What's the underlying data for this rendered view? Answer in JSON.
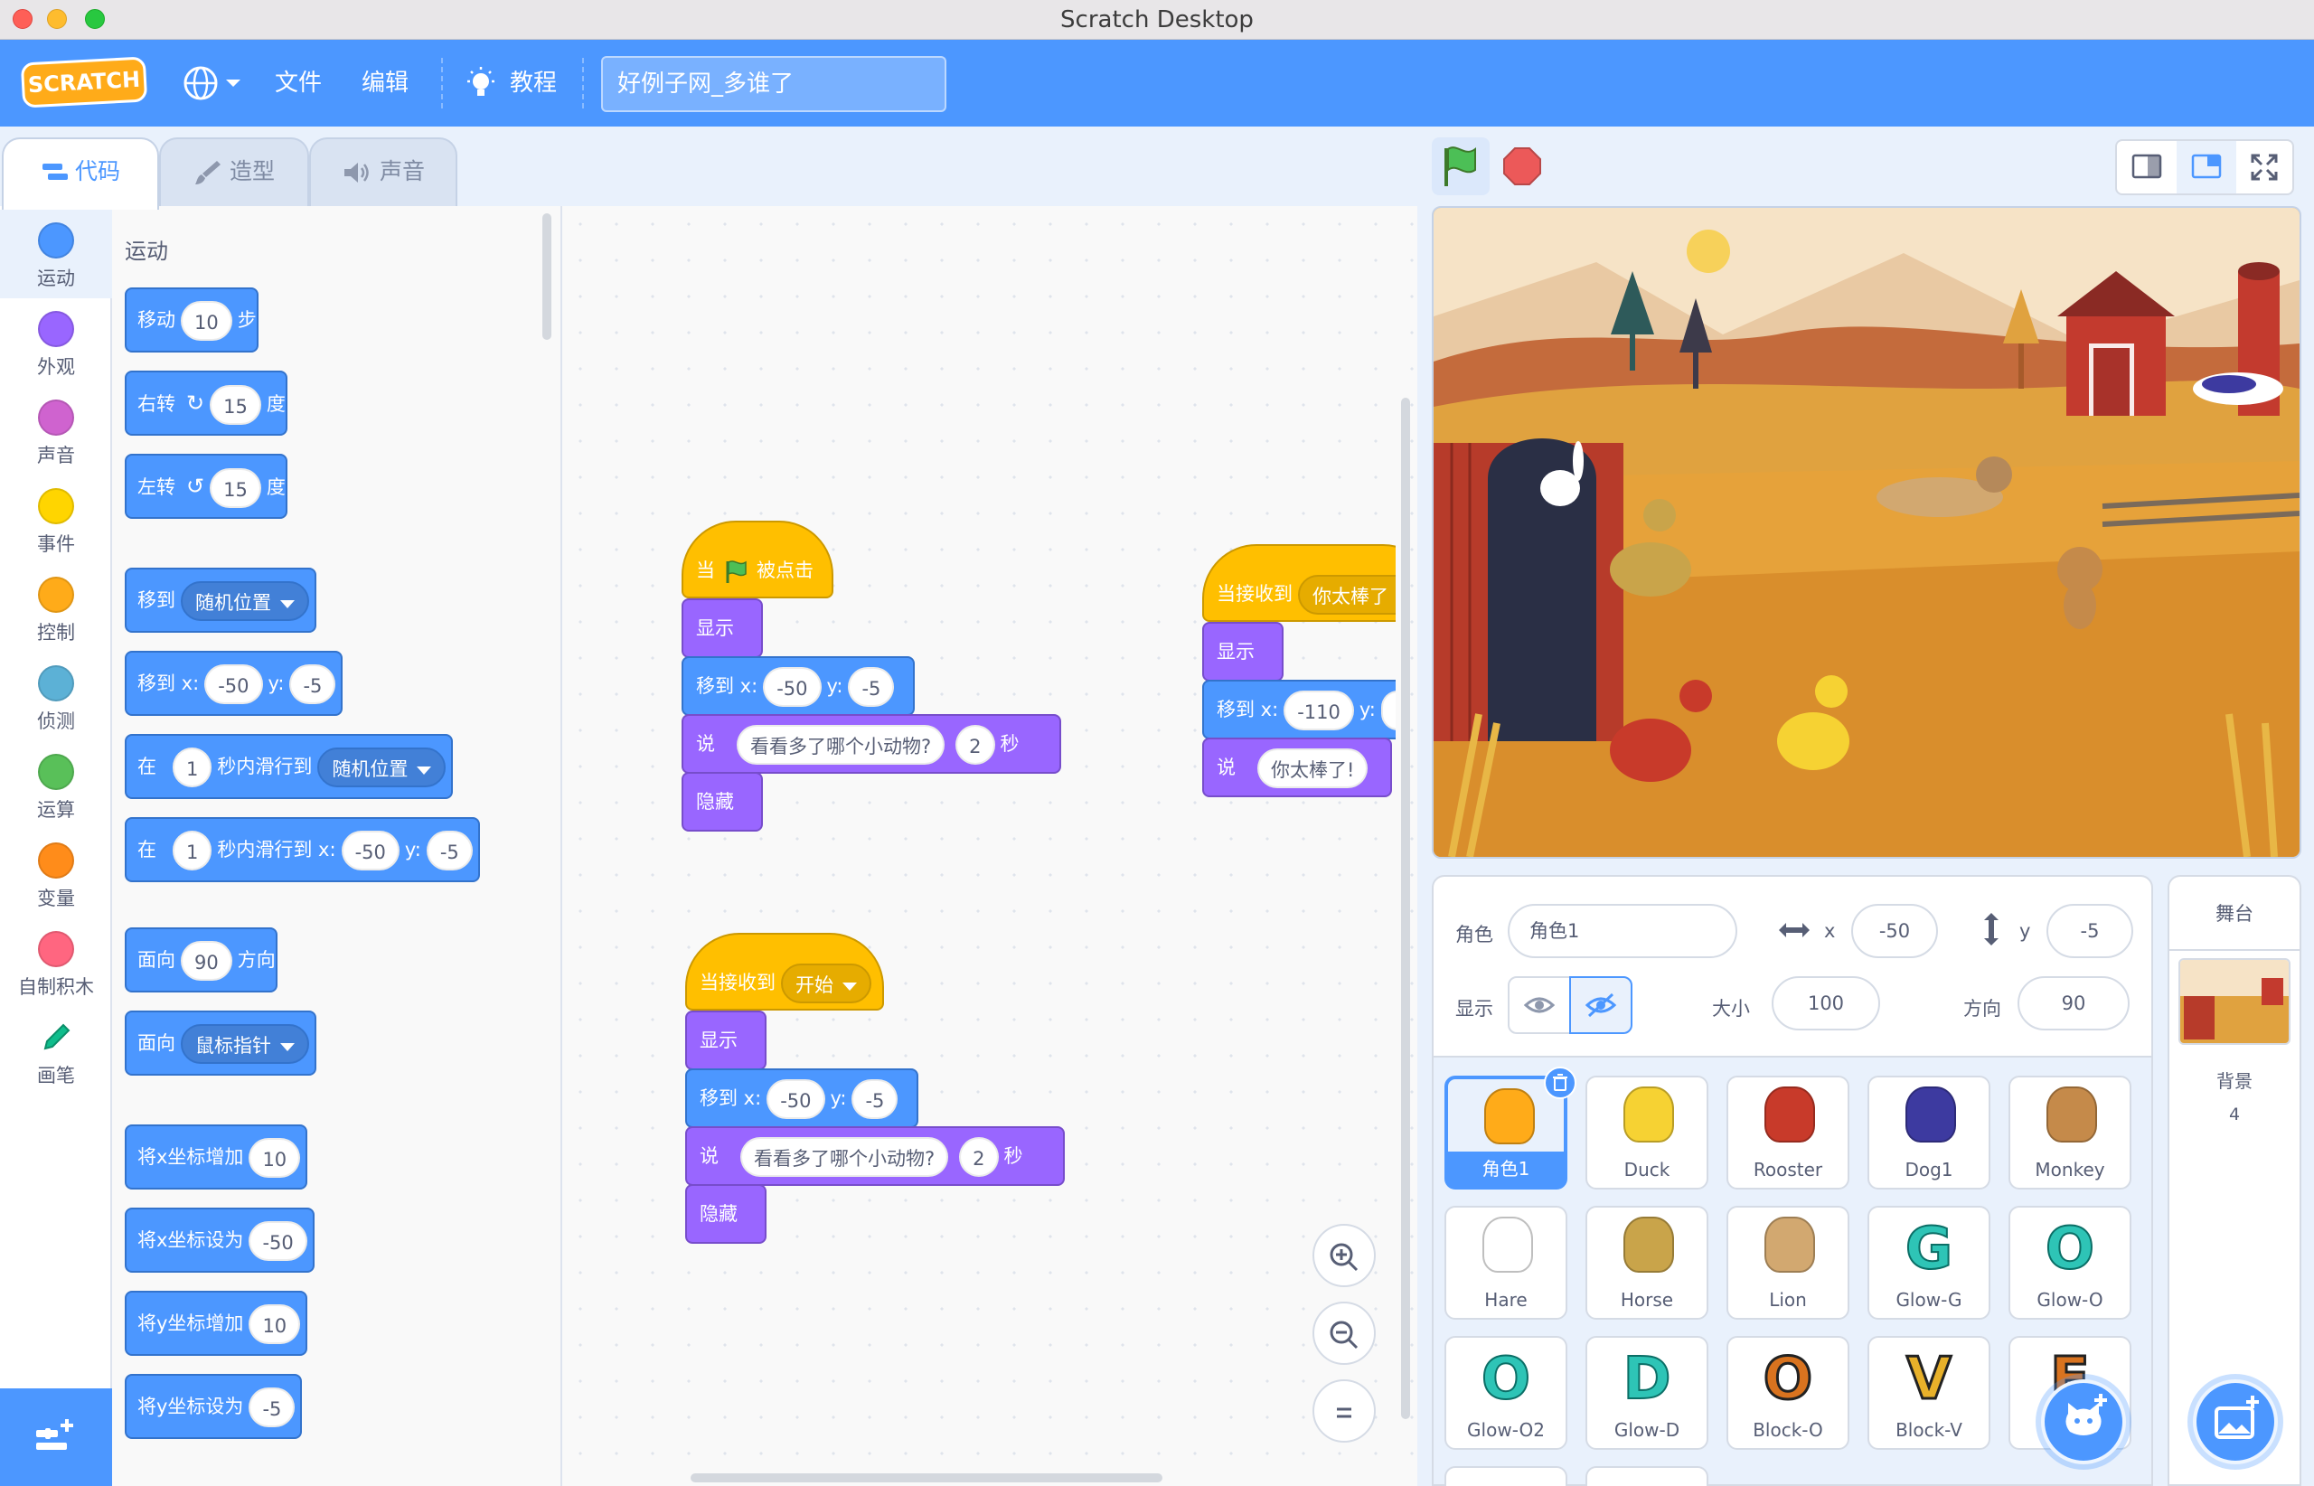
{
  "window": {
    "title": "Scratch Desktop"
  },
  "menubar": {
    "logo": "SCRATCH",
    "file": "文件",
    "edit": "编辑",
    "tutorials": "教程",
    "project_title": "好例子网_多谁了"
  },
  "tabs": [
    {
      "label": "代码"
    },
    {
      "label": "造型"
    },
    {
      "label": "声音"
    }
  ],
  "categories": [
    {
      "label": "运动",
      "color": "#4c97ff"
    },
    {
      "label": "外观",
      "color": "#9966ff"
    },
    {
      "label": "声音",
      "color": "#cf63cf"
    },
    {
      "label": "事件",
      "color": "#ffd500"
    },
    {
      "label": "控制",
      "color": "#ffab19"
    },
    {
      "label": "侦测",
      "color": "#5cb1d6"
    },
    {
      "label": "运算",
      "color": "#59c059"
    },
    {
      "label": "变量",
      "color": "#ff8c1a"
    },
    {
      "label": "自制积木",
      "color": "#ff6680"
    },
    {
      "label": "画笔",
      "color": "#0fbd8c"
    }
  ],
  "palette": {
    "section_title": "运动",
    "move": {
      "a": "移动",
      "v": "10",
      "b": "步"
    },
    "turn_right": {
      "a": "右转",
      "v": "15",
      "b": "度"
    },
    "turn_left": {
      "a": "左转",
      "v": "15",
      "b": "度"
    },
    "goto": {
      "a": "移到",
      "dd": "随机位置"
    },
    "goto_xy": {
      "a": "移到 x:",
      "x": "-50",
      "yl": "y:",
      "y": "-5"
    },
    "glide": {
      "a": "在",
      "v": "1",
      "b": "秒内滑行到",
      "dd": "随机位置"
    },
    "glide_xy": {
      "a": "在",
      "v": "1",
      "b": "秒内滑行到 x:",
      "x": "-50",
      "yl": "y:",
      "y": "-5"
    },
    "point_dir": {
      "a": "面向",
      "v": "90",
      "b": "方向"
    },
    "point_towards": {
      "a": "面向",
      "dd": "鼠标指针"
    },
    "change_x": {
      "a": "将x坐标增加",
      "v": "10"
    },
    "set_x": {
      "a": "将x坐标设为",
      "v": "-50"
    },
    "change_y": {
      "a": "将y坐标增加",
      "v": "10"
    },
    "set_y": {
      "a": "将y坐标设为",
      "v": "-5"
    }
  },
  "scripts": {
    "s1": {
      "hat_a": "当",
      "hat_b": "被点击",
      "show": "显示",
      "goto_a": "移到 x:",
      "x": "-50",
      "yl": "y:",
      "y": "-5",
      "say_a": "说",
      "say_msg": "看看多了哪个小动物?",
      "say_secs": "2",
      "say_b": "秒",
      "hide": "隐藏"
    },
    "s2": {
      "hat_a": "当接收到",
      "hat_dd": "开始",
      "show": "显示",
      "goto_a": "移到 x:",
      "x": "-50",
      "yl": "y:",
      "y": "-5",
      "say_a": "说",
      "say_msg": "看看多了哪个小动物?",
      "say_secs": "2",
      "say_b": "秒",
      "hide": "隐藏"
    },
    "s3": {
      "hat_a": "当接收到",
      "hat_dd": "你太棒了",
      "show": "显示",
      "goto_a": "移到 x:",
      "x": "-110",
      "yl": "y:",
      "say_a": "说",
      "say_msg": "你太棒了!"
    }
  },
  "sprite_info": {
    "sprite_label": "角色",
    "sprite_name": "角色1",
    "x_label": "x",
    "x": "-50",
    "y_label": "y",
    "y": "-5",
    "show_label": "显示",
    "size_label": "大小",
    "size": "100",
    "direction_label": "方向",
    "direction": "90"
  },
  "sprites": [
    {
      "name": "角色1"
    },
    {
      "name": "Duck"
    },
    {
      "name": "Rooster"
    },
    {
      "name": "Dog1"
    },
    {
      "name": "Monkey"
    },
    {
      "name": "Hare"
    },
    {
      "name": "Horse"
    },
    {
      "name": "Lion"
    },
    {
      "name": "Glow-G",
      "letter": "G"
    },
    {
      "name": "Glow-O",
      "letter": "O"
    },
    {
      "name": "Glow-O2",
      "letter": "O"
    },
    {
      "name": "Glow-D",
      "letter": "D"
    },
    {
      "name": "Block-O",
      "letter": "O"
    },
    {
      "name": "Block-V",
      "letter": "V"
    },
    {
      "name": "",
      "letter": "E"
    }
  ],
  "stage_panel": {
    "title": "舞台",
    "backdrop_label": "背景",
    "backdrop_count": "4"
  }
}
